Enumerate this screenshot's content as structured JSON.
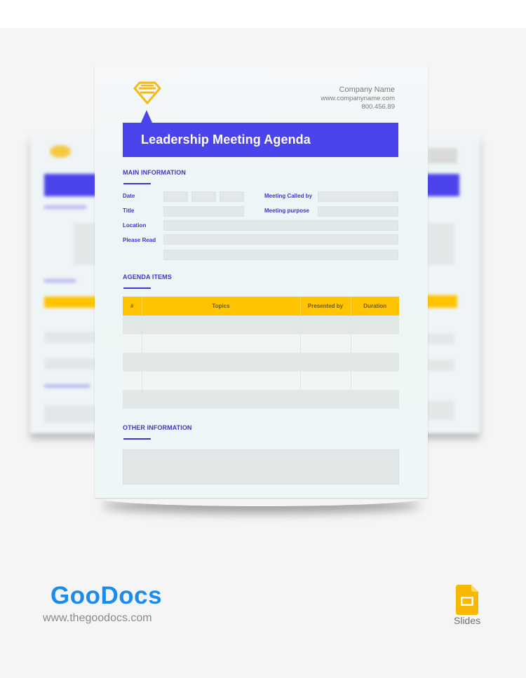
{
  "document": {
    "company_name": "Company Name",
    "company_website": "www.companyname.com",
    "company_phone": "800.456.89",
    "title": "Leadership Meeting Agenda",
    "logo_icon": "diamond-icon"
  },
  "main_information": {
    "heading": "MAIN INFORMATION",
    "labels": {
      "date": "Date",
      "title": "Title",
      "location": "Location",
      "please_read": "Please Read",
      "meeting_called_by": "Meeting Called by",
      "meeting_purpose": "Meeting purpose"
    },
    "values": {
      "date_day": "",
      "date_month": "",
      "date_year": "",
      "title": "",
      "location": "",
      "please_read_1": "",
      "please_read_2": "",
      "meeting_called_by": "",
      "meeting_purpose": ""
    }
  },
  "agenda_items": {
    "heading": "AGENDA ITEMS",
    "columns": [
      "#",
      "Topics",
      "Presented by",
      "Duration"
    ],
    "rows": [
      [
        "",
        "",
        "",
        ""
      ],
      [
        "",
        "",
        "",
        ""
      ],
      [
        "",
        "",
        "",
        ""
      ],
      [
        "",
        "",
        "",
        ""
      ],
      [
        "",
        "",
        "",
        ""
      ]
    ]
  },
  "other_information": {
    "heading": "OTHER INFORMATION",
    "value": ""
  },
  "branding": {
    "logo_text": "GooDocs",
    "url": "www.thegoodocs.com",
    "platform_label": "Slides",
    "platform_icon": "google-slides-icon"
  },
  "colors": {
    "primary": "#4b44ec",
    "heading": "#3f37c9",
    "accent": "#ffc300",
    "field": "#e2e7e7",
    "brand": "#1a8cf0"
  }
}
